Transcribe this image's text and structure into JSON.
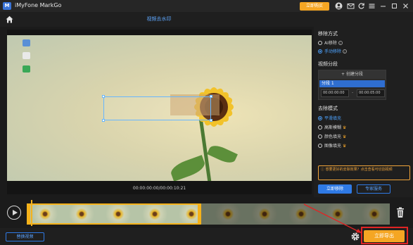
{
  "app": {
    "title": "iMyFone MarkGo",
    "logo_text": "M",
    "buy_label": "立即购买"
  },
  "header": {
    "page_title": "视频去水印"
  },
  "preview": {
    "time_readout": "00:00:00:00/00:00:10:21"
  },
  "panel": {
    "remove_method": {
      "title": "移除方式",
      "options": [
        {
          "label": "AI移除",
          "selected": false
        },
        {
          "label": "手动移除",
          "selected": true
        }
      ]
    },
    "segments": {
      "title": "视频分段",
      "create_label": "+ 创建分段",
      "item_label": "分段 1",
      "start_time": "00:00:00:00",
      "end_time": "00:00:05:00",
      "separator": "-"
    },
    "removal_mode": {
      "title": "去除模式",
      "options": [
        {
          "label": "平滑填充",
          "selected": true,
          "premium": false
        },
        {
          "label": "高斯模糊",
          "selected": false,
          "premium": true
        },
        {
          "label": "颜色填充",
          "selected": false,
          "premium": true
        },
        {
          "label": "图像填充",
          "selected": false,
          "premium": true
        }
      ]
    },
    "tip_text": "想要更好的去除效果？点击查看可切割视频",
    "remove_now_label": "立即移除",
    "expert_label": "专家服务"
  },
  "bottom": {
    "replace_label": "替换视频",
    "export_label": "立即导出"
  },
  "colors": {
    "accent_blue": "#2f7ae5",
    "accent_orange": "#f5a623",
    "highlight_red": "#e02424"
  }
}
